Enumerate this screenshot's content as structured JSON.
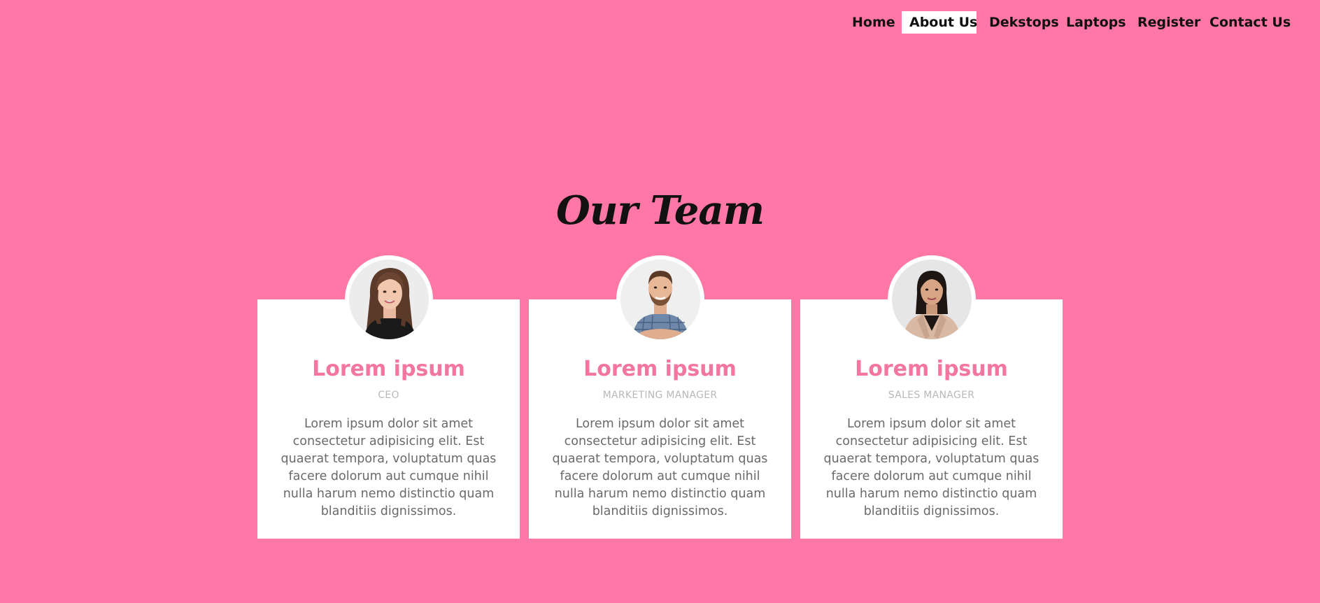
{
  "nav": {
    "items": [
      {
        "label": "Home",
        "active": false
      },
      {
        "label": "About Us",
        "active": true
      },
      {
        "label": "Dekstops",
        "active": false
      },
      {
        "label": "Laptops",
        "active": false
      },
      {
        "label": "Register",
        "active": false
      },
      {
        "label": "Contact Us",
        "active": false
      }
    ]
  },
  "section": {
    "title": "Our Team"
  },
  "team": [
    {
      "name": "Lorem ipsum",
      "role": "CEO",
      "description": "Lorem ipsum dolor sit amet consectetur adipisicing elit. Est quaerat tempora, voluptatum quas facere dolorum aut cumque nihil nulla harum nemo distinctio quam blanditiis dignissimos."
    },
    {
      "name": "Lorem ipsum",
      "role": "MARKETING MANAGER",
      "description": "Lorem ipsum dolor sit amet consectetur adipisicing elit. Est quaerat tempora, voluptatum quas facere dolorum aut cumque nihil nulla harum nemo distinctio quam blanditiis dignissimos."
    },
    {
      "name": "Lorem ipsum",
      "role": "SALES MANAGER",
      "description": "Lorem ipsum dolor sit amet consectetur adipisicing elit. Est quaerat tempora, voluptatum quas facere dolorum aut cumque nihil nulla harum nemo distinctio quam blanditiis dignissimos."
    }
  ],
  "colors": {
    "background": "#ff77a6",
    "accent": "#f2769e",
    "card": "#ffffff",
    "role_text": "#b8b8b8",
    "body_text": "#6a6a6a"
  }
}
